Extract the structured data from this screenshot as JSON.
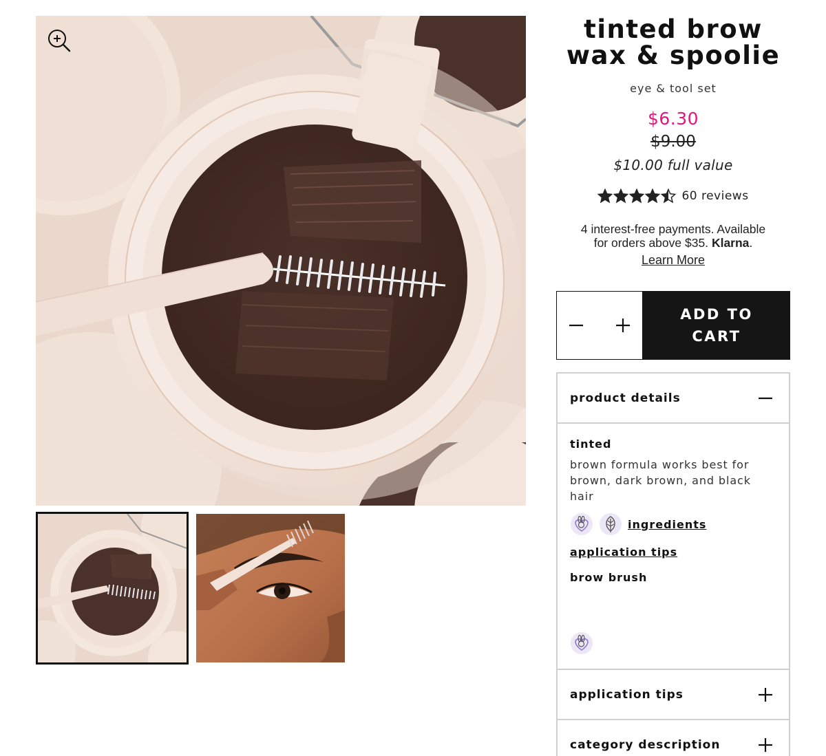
{
  "gallery": {
    "zoom_icon": "zoom-in-icon",
    "thumbnails": [
      "product-thumbnail",
      "model-thumbnail"
    ]
  },
  "product": {
    "title_line1": "tinted brow",
    "title_line2": "wax & spoolie",
    "subtitle": "eye & tool set",
    "sale_price": "$6.30",
    "original_price": "$9.00",
    "full_value": "$10.00 full value",
    "rating": 4.5,
    "reviews_label": "60 reviews",
    "klarna_text_1": "4 interest-free payments. Available",
    "klarna_text_2": "for orders above $35.",
    "klarna_brand": "Klarna",
    "klarna_period": ".",
    "learn_more": "Learn More"
  },
  "cart": {
    "add_label_line1": "ADD TO",
    "add_label_line2": "CART"
  },
  "accordion": {
    "details_title": "product details",
    "details_heading": "tinted",
    "details_text": "brown formula works best for brown, dark brown, and black hair",
    "ingredients_link": "ingredients",
    "application_link": "application tips",
    "brush_heading": "brow brush",
    "application_title": "application tips",
    "category_title": "category description"
  },
  "colors": {
    "sale": "#e6147c",
    "button": "#151515",
    "badge": "#8f7bd0"
  }
}
